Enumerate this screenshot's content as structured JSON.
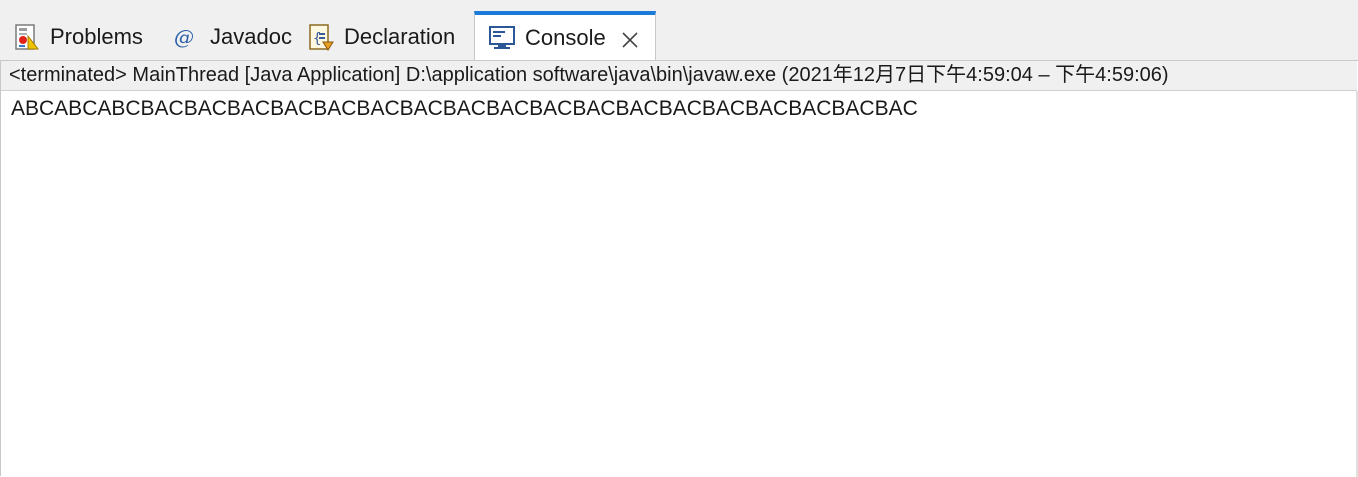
{
  "tabs": [
    {
      "label": "Problems",
      "icon": "problems-icon"
    },
    {
      "label": "Javadoc",
      "icon": "javadoc-at-icon"
    },
    {
      "label": "Declaration",
      "icon": "declaration-icon"
    },
    {
      "label": "Console",
      "icon": "console-icon",
      "active": true
    }
  ],
  "console": {
    "status": "<terminated> MainThread [Java Application] D:\\application software\\java\\bin\\javaw.exe  (2021年12月7日下午4:59:04 – 下午4:59:06)",
    "output": "ABCABCABCBACBACBACBACBACBACBACBACBACBACBACBACBACBACBACBACBACBAC"
  },
  "colors": {
    "active_tab_accent": "#1c7ad9",
    "tabbar_bg": "#f0f0f0",
    "panel_bg": "#ffffff"
  }
}
